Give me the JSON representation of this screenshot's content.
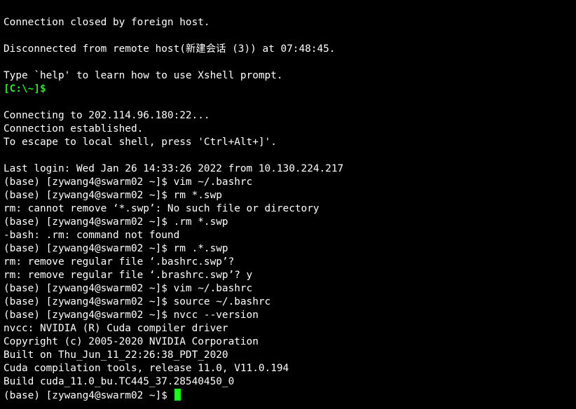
{
  "terminal": {
    "lines": {
      "0": "Connection closed by foreign host.",
      "1": "",
      "2": "Disconnected from remote host(新建会话 (3)) at 07:48:45.",
      "3": "",
      "4": "Type `help' to learn how to use Xshell prompt.",
      "5": "[C:\\~]$",
      "6": "",
      "7": "Connecting to 202.114.96.180:22...",
      "8": "Connection established.",
      "9": "To escape to local shell, press 'Ctrl+Alt+]'.",
      "10": "",
      "11": "Last login: Wed Jan 26 14:33:26 2022 from 10.130.224.217",
      "12": "(base) [zywang4@swarm02 ~]$ vim ~/.bashrc",
      "13": "(base) [zywang4@swarm02 ~]$ rm *.swp",
      "14": "rm: cannot remove ‘*.swp’: No such file or directory",
      "15": "(base) [zywang4@swarm02 ~]$ .rm *.swp",
      "16": "-bash: .rm: command not found",
      "17": "(base) [zywang4@swarm02 ~]$ rm .*.swp",
      "18": "rm: remove regular file ‘.bashrc.swp’?",
      "19": "rm: remove regular file ‘.brashrc.swp’? y",
      "20": "(base) [zywang4@swarm02 ~]$ vim ~/.bashrc",
      "21": "(base) [zywang4@swarm02 ~]$ source ~/.bashrc",
      "22": "(base) [zywang4@swarm02 ~]$ nvcc --version",
      "23": "nvcc: NVIDIA (R) Cuda compiler driver",
      "24": "Copyright (c) 2005-2020 NVIDIA Corporation",
      "25": "Built on Thu_Jun_11_22:26:38_PDT_2020",
      "26": "Cuda compilation tools, release 11.0, V11.0.194",
      "27": "Build cuda_11.0_bu.TC445_37.28540450_0",
      "28": "(base) [zywang4@swarm02 ~]$ "
    },
    "colors": {
      "background": "#000000",
      "text": "#ffffff",
      "local_prompt": "#2ee62e",
      "cursor": "#1aff1a"
    }
  }
}
